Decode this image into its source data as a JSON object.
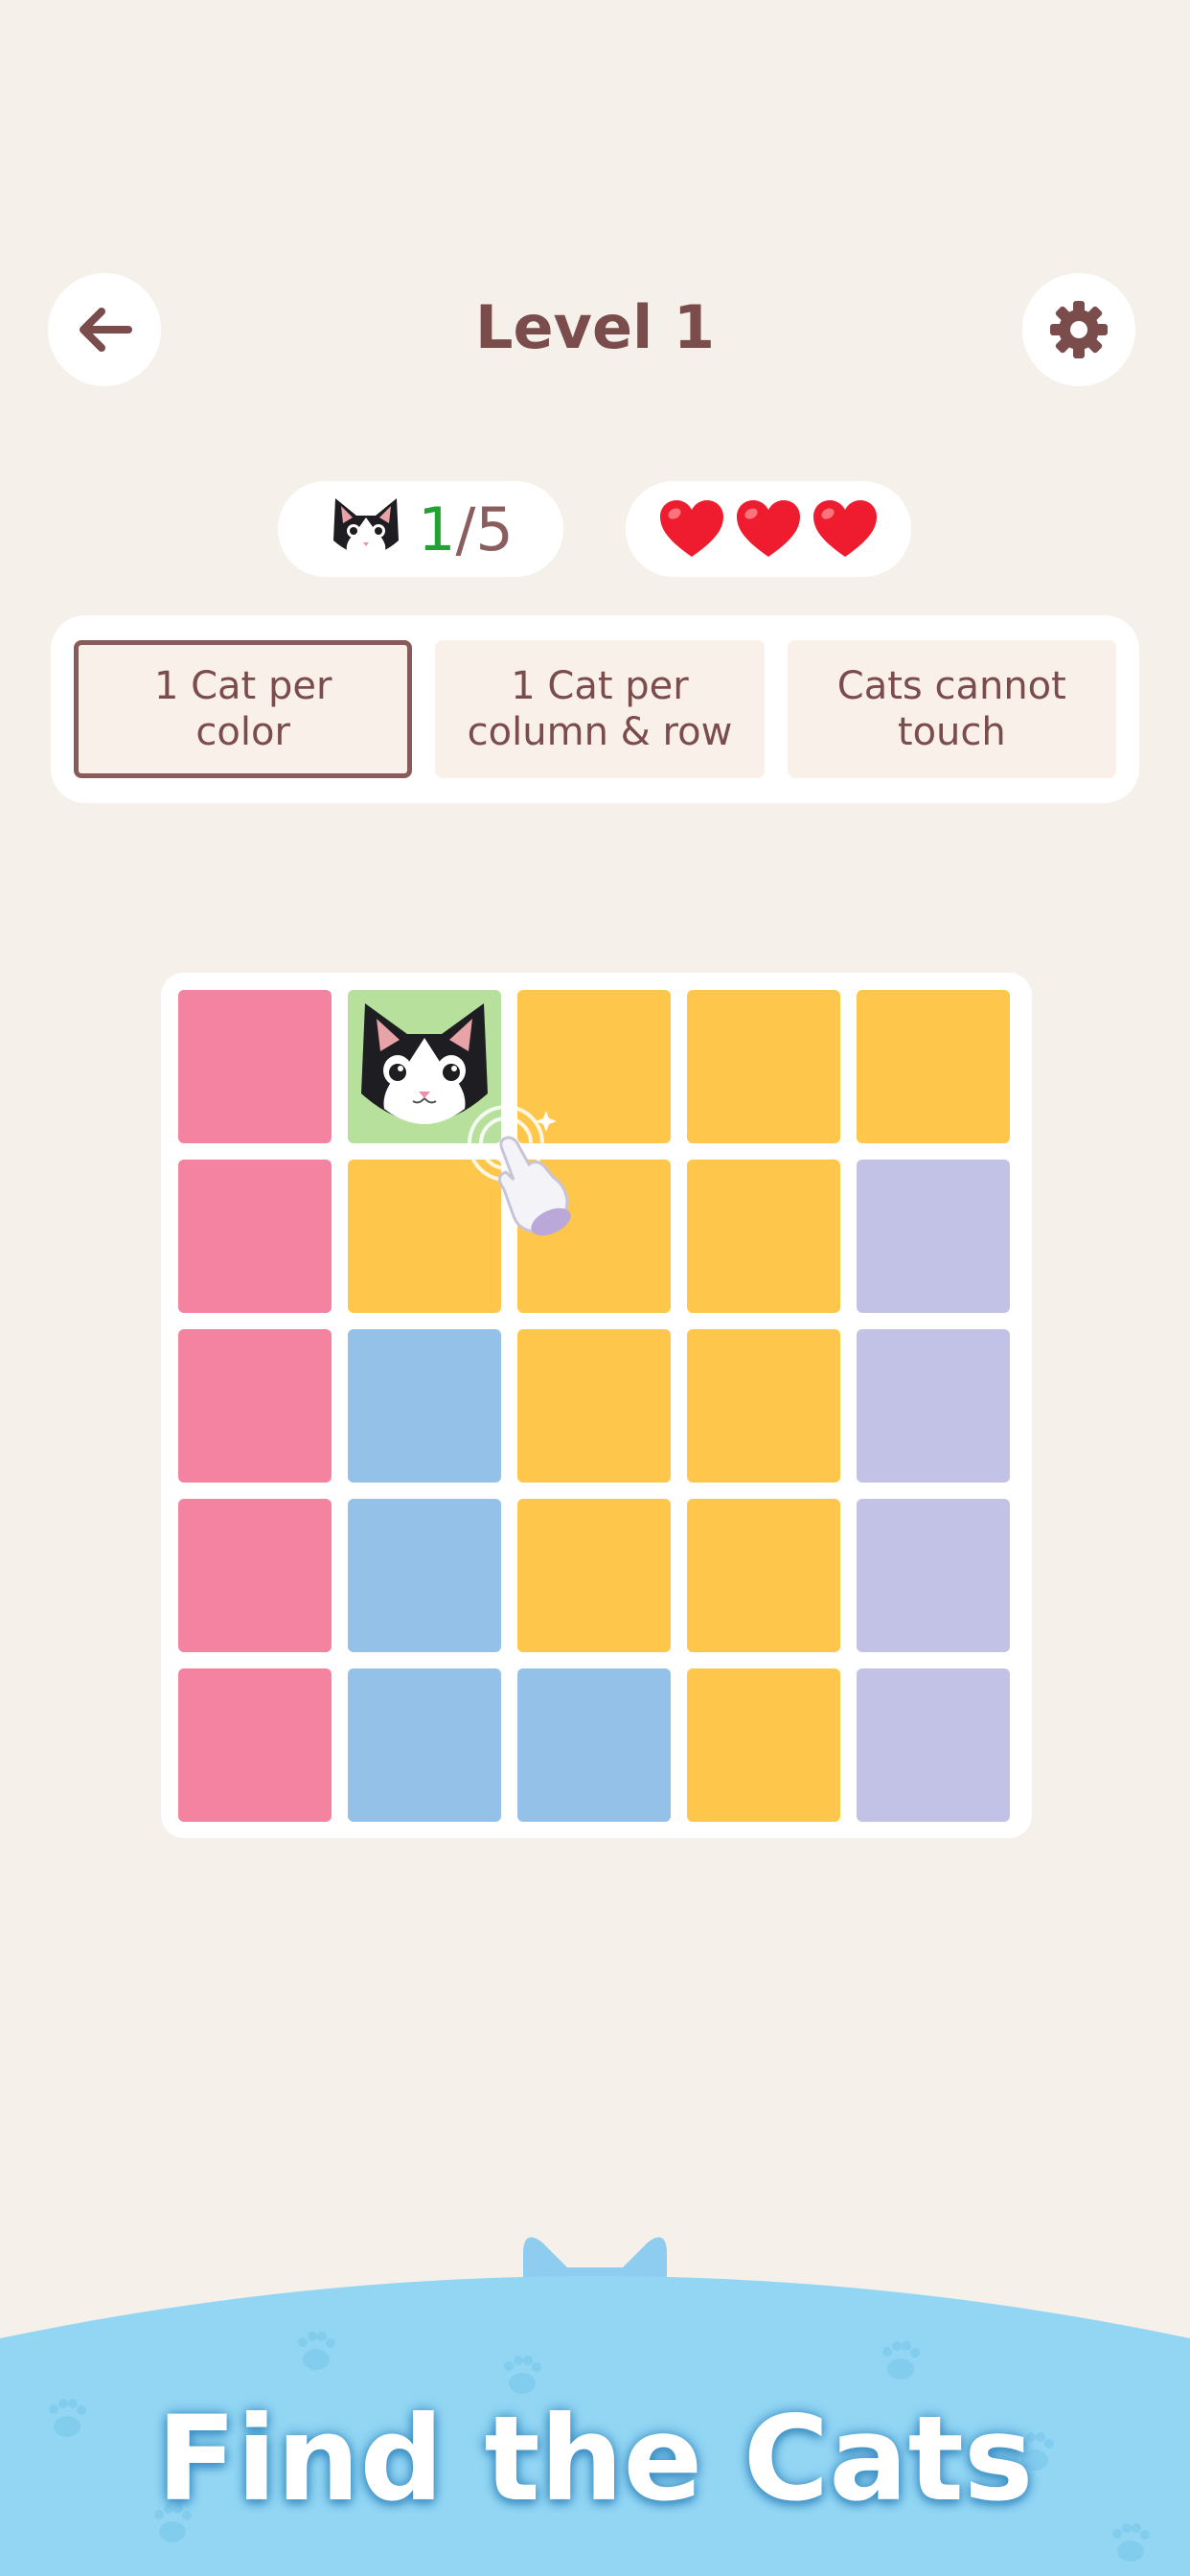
{
  "header": {
    "title": "Level 1",
    "back_icon": "arrow-left-icon",
    "settings_icon": "gear-icon"
  },
  "status": {
    "cats_found": "1",
    "cats_total": "/5",
    "counter_icon": "cat-face-icon",
    "lives": 3,
    "life_icon": "heart-icon"
  },
  "rules": [
    {
      "label": "1 Cat per\ncolor",
      "active": true
    },
    {
      "label": "1 Cat per\ncolumn & row",
      "active": false
    },
    {
      "label": "Cats cannot\ntouch",
      "active": false
    }
  ],
  "board": {
    "colors": {
      "P": "#f483a2",
      "Y": "#fec74b",
      "B": "#94c1e8",
      "V": "#c2c2e6",
      "G": "#b6e09c"
    },
    "grid": [
      [
        "P",
        "G",
        "Y",
        "Y",
        "Y"
      ],
      [
        "P",
        "Y",
        "Y",
        "Y",
        "V"
      ],
      [
        "P",
        "B",
        "Y",
        "Y",
        "V"
      ],
      [
        "P",
        "B",
        "Y",
        "Y",
        "V"
      ],
      [
        "P",
        "B",
        "B",
        "Y",
        "V"
      ]
    ],
    "cat_cell": {
      "row": 0,
      "col": 1
    },
    "cursor_icon": "tap-hand-icon"
  },
  "footer": {
    "headline": "Find the Cats"
  }
}
